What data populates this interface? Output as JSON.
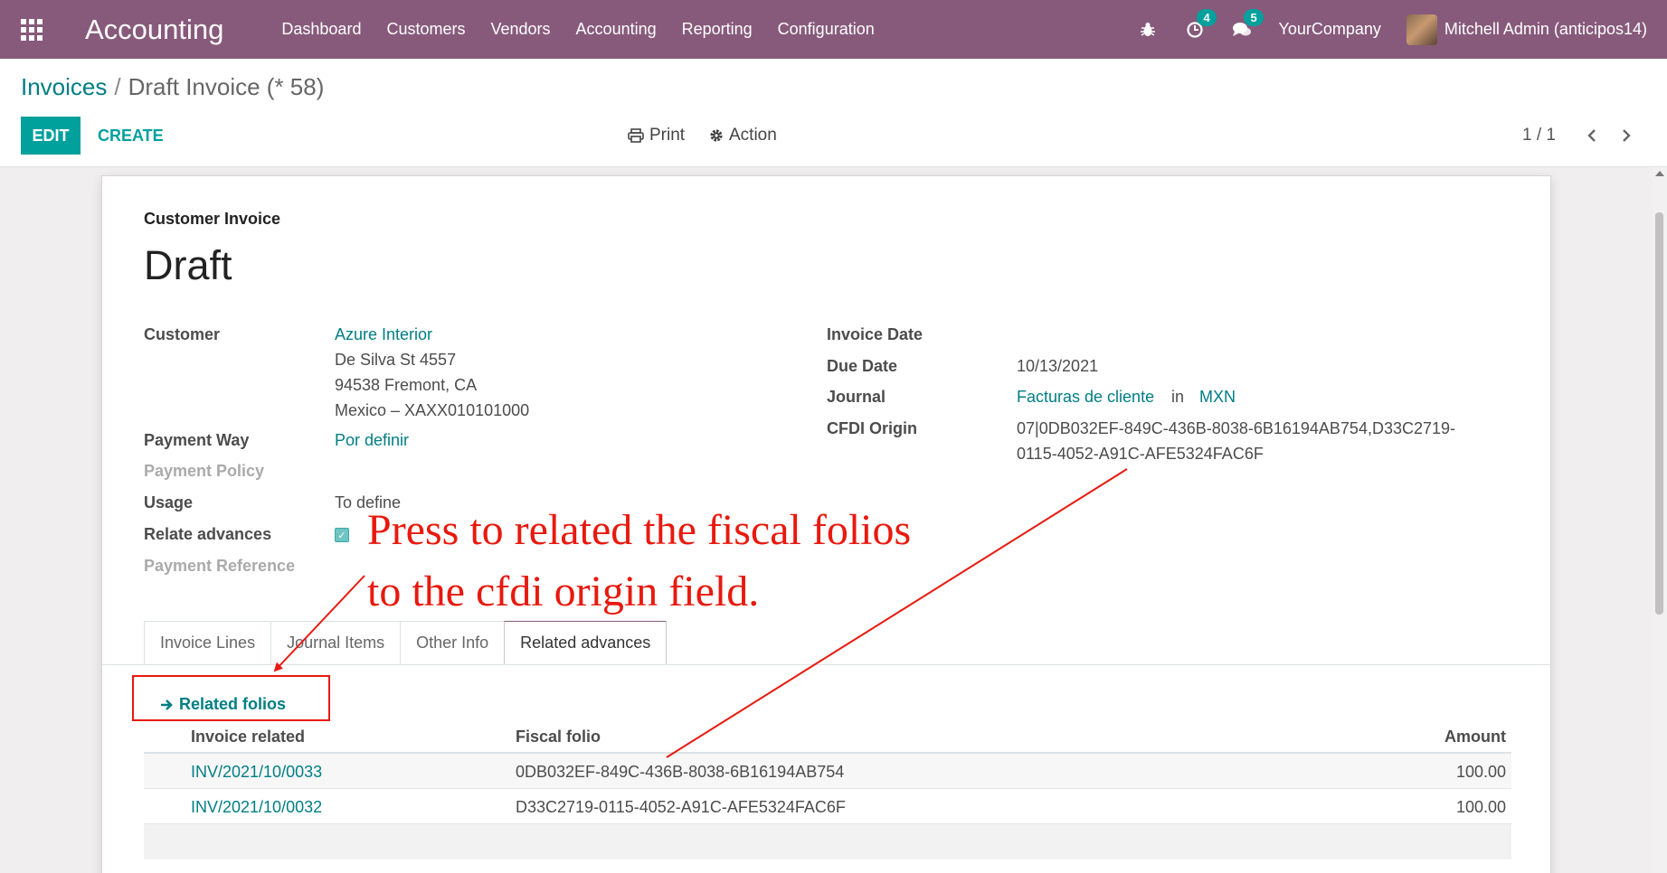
{
  "navbar": {
    "app_title": "Accounting",
    "menu": [
      "Dashboard",
      "Customers",
      "Vendors",
      "Accounting",
      "Reporting",
      "Configuration"
    ],
    "activity_count": "4",
    "message_count": "5",
    "company": "YourCompany",
    "user": "Mitchell Admin (anticipos14)"
  },
  "control_panel": {
    "breadcrumb_parent": "Invoices",
    "breadcrumb_separator": "/",
    "breadcrumb_current": "Draft Invoice (* 58)",
    "edit_label": "EDIT",
    "create_label": "CREATE",
    "print_label": "Print",
    "action_label": "Action",
    "pager": "1 / 1"
  },
  "form": {
    "doc_type": "Customer Invoice",
    "doc_name": "Draft",
    "customer_label": "Customer",
    "customer_name": "Azure Interior",
    "customer_address": [
      "De Silva St 4557",
      "94538 Fremont, CA",
      "Mexico – XAXX010101000"
    ],
    "payment_way_label": "Payment Way",
    "payment_way_value": "Por definir",
    "payment_policy_label": "Payment Policy",
    "usage_label": "Usage",
    "usage_value": "To define",
    "relate_advances_label": "Relate advances",
    "relate_advances_checked": true,
    "payment_reference_label": "Payment Reference",
    "invoice_date_label": "Invoice Date",
    "due_date_label": "Due Date",
    "due_date_value": "10/13/2021",
    "journal_label": "Journal",
    "journal_value": "Facturas de cliente",
    "journal_in": "in",
    "currency": "MXN",
    "cfdi_origin_label": "CFDI Origin",
    "cfdi_origin_value": [
      "07|0DB032EF-849C-436B-8038-6B16194AB754,D33C2719-",
      "0115-4052-A91C-AFE5324FAC6F"
    ]
  },
  "tabs": [
    "Invoice Lines",
    "Journal Items",
    "Other Info",
    "Related advances"
  ],
  "active_tab": "Related advances",
  "related": {
    "button_label": "Related folios",
    "columns": [
      "Invoice related",
      "Fiscal folio",
      "Amount"
    ],
    "rows": [
      [
        "INV/2021/10/0033",
        "0DB032EF-849C-436B-8038-6B16194AB754",
        "100.00"
      ],
      [
        "INV/2021/10/0032",
        "D33C2719-0115-4052-A91C-AFE5324FAC6F",
        "100.00"
      ]
    ]
  },
  "annotation": {
    "line1": "Press to related the fiscal folios",
    "line2": "to the cfdi origin field.",
    "color": "#e8190e"
  },
  "colors": {
    "navbar": "#875a7b",
    "primary": "#00a09d",
    "link": "#017e84"
  }
}
